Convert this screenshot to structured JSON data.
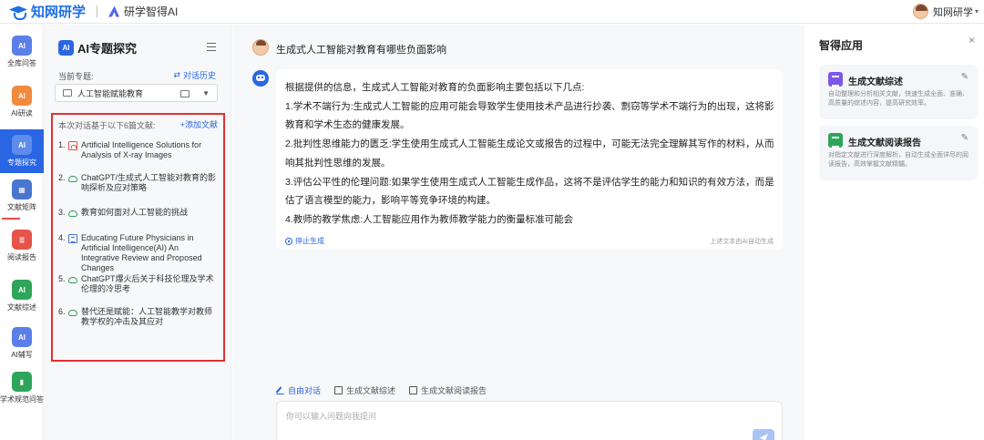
{
  "header": {
    "logo_text": "知网研学",
    "product_name": "研学智得AI",
    "user_name": "知网研学"
  },
  "nav": {
    "items": [
      {
        "icon": "AI",
        "label": "全库问答",
        "color": "#5b7fe8"
      },
      {
        "icon": "AI",
        "label": "AI研读",
        "color": "#f08a3c"
      },
      {
        "icon": "AI",
        "label": "专题探究",
        "color": "#2966e3"
      },
      {
        "icon": "▦",
        "label": "文献矩阵",
        "color": "#4a76d0"
      },
      {
        "icon": "≣",
        "label": "阅读报告",
        "color": "#e5534b"
      },
      {
        "icon": "AI",
        "label": "文献综述",
        "color": "#2fa55a"
      },
      {
        "icon": "AI",
        "label": "AI辅写",
        "color": "#5b7fe8"
      },
      {
        "icon": "▮",
        "label": "学术规范问答",
        "color": "#2fa55a"
      }
    ]
  },
  "panel": {
    "logo_icon": "AI",
    "title": "AI专题探究",
    "current_label": "当前专题:",
    "history_label": "对话历史",
    "topic_value": "人工智能赋能教育",
    "list_header": "本次对话基于以下6篇文献:",
    "add_doc_label": "+添加文献",
    "docs": [
      {
        "num": "1.",
        "type": "pdf",
        "title": "Artificial Intelligence Solutions for Analysis of X-ray Images"
      },
      {
        "num": "2.",
        "type": "cloud",
        "title": "ChatGPT/生成式人工智能对教育的影响探析及应对策略"
      },
      {
        "num": "3.",
        "type": "cloud",
        "title": "教育如何面对人工智能的挑战"
      },
      {
        "num": "4.",
        "type": "doc",
        "title": "Educating Future Physicians in Artificial Intelligence(AI) An Integrative Review and Proposed Changes"
      },
      {
        "num": "5.",
        "type": "cloud",
        "title": "ChatGPT爆火后关于科技伦理及学术伦理的冷思考"
      },
      {
        "num": "6.",
        "type": "cloud",
        "title": "替代还是赋能：人工智能教学对教师教学权的冲击及其应对"
      }
    ]
  },
  "chat": {
    "question": "生成式人工智能对教育有哪些负面影响",
    "answer_lines": [
      "根据提供的信息，生成式人工智能对教育的负面影响主要包括以下几点:",
      "1.学术不端行为:生成式人工智能的应用可能会导致学生使用技术产品进行抄袭、剽窃等学术不端行为的出现，这将影响",
      "教育和学术生态的健康发展。",
      "2.批判性思维能力的匮乏:学生使用生成式人工智能生成论文或报告的过程中，可能无法完全理解其写作的材料，从而影",
      "响其批判性思维的发展。",
      "3.评估公平性的伦理问题:如果学生使用生成式人工智能生成作品，这将不是评估学生的能力和知识的有效方法，而是评",
      "估了语言模型的能力，影响平等竞争环境的构建。",
      "4.教师的教学焦虑:人工智能应用作为教师教学能力的衡量标准可能会"
    ],
    "stop_label": "停止生成",
    "ai_note": "上述文本由AI自动生成",
    "modes": [
      {
        "label": "自由对话",
        "active": true
      },
      {
        "label": "生成文献综述",
        "active": false
      },
      {
        "label": "生成文献阅读报告",
        "active": false
      }
    ],
    "input_placeholder": "你可以输入问题向我提问"
  },
  "right_panel": {
    "title": "智得应用",
    "close_label": "×",
    "cards": [
      {
        "title": "生成文献综述",
        "desc": "自动整理和分析相关文献，快速生成全面、准确、高质量的综述内容，提高研究效率。",
        "icon_color": "#7b57e8"
      },
      {
        "title": "生成文献阅读报告",
        "desc": "对指定文献进行深度解析，自动生成全面详尽的阅读报告，高效掌握文献精髓。",
        "icon_color": "#2fa55a"
      }
    ]
  }
}
